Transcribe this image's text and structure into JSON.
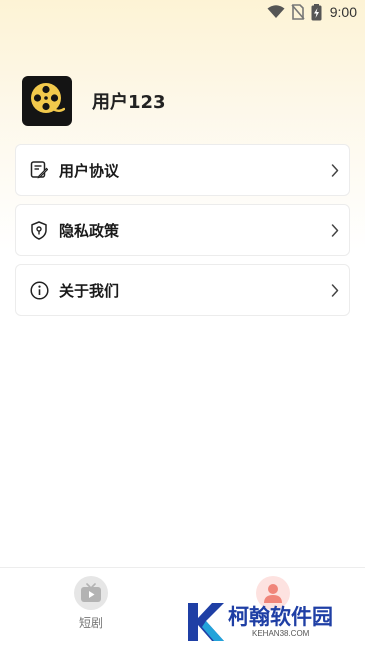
{
  "status_bar": {
    "time": "9:00",
    "icons": [
      "wifi-icon",
      "no-sim-icon",
      "battery-charging-icon"
    ]
  },
  "profile": {
    "username": "用户123",
    "logo_icon": "film-reel-icon"
  },
  "menu": {
    "items": [
      {
        "label": "用户协议",
        "icon": "agreement-icon"
      },
      {
        "label": "隐私政策",
        "icon": "shield-lock-icon"
      },
      {
        "label": "关于我们",
        "icon": "info-icon"
      }
    ]
  },
  "bottom_nav": {
    "items": [
      {
        "label": "短剧",
        "icon": "tv-play-icon"
      },
      {
        "label": "",
        "icon": "user-icon"
      }
    ]
  },
  "watermark": {
    "title": "柯翰软件园",
    "subtitle": "KEHAN38.COM"
  },
  "colors": {
    "accent": "#f4b6a9",
    "logo_bg": "#141414",
    "logo_reel": "#f2c94c",
    "watermark_blue": "#1f3fa5"
  }
}
